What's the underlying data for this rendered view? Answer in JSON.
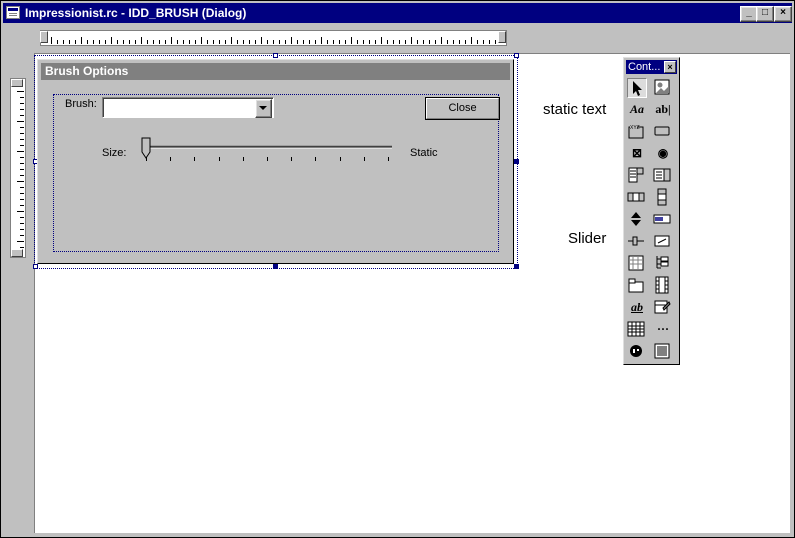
{
  "window": {
    "title": "Impressionist.rc - IDD_BRUSH (Dialog)",
    "minimize_glyph": "_",
    "maximize_glyph": "□",
    "close_glyph": "×"
  },
  "dialog": {
    "title": "Brush Options",
    "brush_label": "Brush:",
    "brush_value": "",
    "close_label": "Close",
    "size_label": "Size:",
    "static_label": "Static",
    "slider_value_fraction": 0.0,
    "slider_ticks": 11
  },
  "toolbox": {
    "title": "Cont...",
    "close_glyph": "×",
    "tools": [
      {
        "icon": "pointer-icon",
        "glyph": "",
        "pressed": true
      },
      {
        "icon": "picture-icon",
        "glyph": ""
      },
      {
        "icon": "static-text-icon",
        "glyph": "Aa"
      },
      {
        "icon": "edit-box-icon",
        "glyph": "ab|"
      },
      {
        "icon": "group-box-icon",
        "glyph": ""
      },
      {
        "icon": "button-icon",
        "glyph": ""
      },
      {
        "icon": "check-box-icon",
        "glyph": "⊠"
      },
      {
        "icon": "radio-button-icon",
        "glyph": "◉"
      },
      {
        "icon": "combo-box-icon",
        "glyph": ""
      },
      {
        "icon": "list-box-icon",
        "glyph": ""
      },
      {
        "icon": "horizontal-scrollbar-icon",
        "glyph": ""
      },
      {
        "icon": "vertical-scrollbar-icon",
        "glyph": ""
      },
      {
        "icon": "spin-icon",
        "glyph": ""
      },
      {
        "icon": "progress-icon",
        "glyph": ""
      },
      {
        "icon": "slider-icon",
        "glyph": ""
      },
      {
        "icon": "hot-key-icon",
        "glyph": ""
      },
      {
        "icon": "list-control-icon",
        "glyph": ""
      },
      {
        "icon": "tree-control-icon",
        "glyph": ""
      },
      {
        "icon": "tab-control-icon",
        "glyph": ""
      },
      {
        "icon": "animate-icon",
        "glyph": ""
      },
      {
        "icon": "rich-edit-icon",
        "glyph": "ab"
      },
      {
        "icon": "date-time-picker-icon",
        "glyph": ""
      },
      {
        "icon": "month-calendar-icon",
        "glyph": ""
      },
      {
        "icon": "ip-address-icon",
        "glyph": "···"
      },
      {
        "icon": "custom-control-icon",
        "glyph": ""
      },
      {
        "icon": "extended-combo-icon",
        "glyph": ""
      }
    ]
  },
  "annotations": {
    "static_text": "static text",
    "slider": "Slider"
  }
}
